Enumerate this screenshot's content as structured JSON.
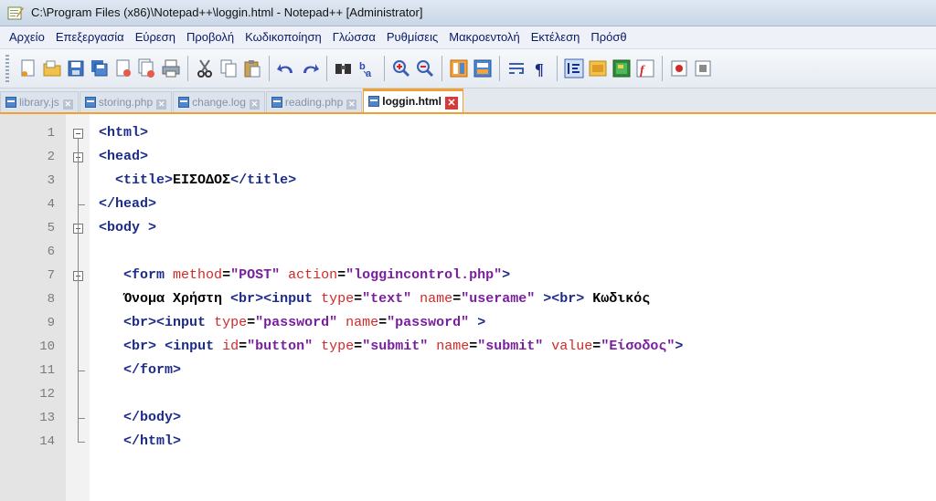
{
  "window": {
    "title": "C:\\Program Files (x86)\\Notepad++\\loggin.html - Notepad++ [Administrator]"
  },
  "menu": [
    "Αρχείο",
    "Επεξεργασία",
    "Εύρεση",
    "Προβολή",
    "Κωδικοποίηση",
    "Γλώσσα",
    "Ρυθμίσεις",
    "Μακροεντολή",
    "Εκτέλεση",
    "Πρόσθ"
  ],
  "toolbar_icons": [
    "new-file-icon",
    "open-file-icon",
    "save-icon",
    "save-all-icon",
    "close-icon",
    "close-all-icon",
    "print-icon",
    "cut-icon",
    "copy-icon",
    "paste-icon",
    "undo-icon",
    "redo-icon",
    "find-icon",
    "replace-icon",
    "zoom-in-icon",
    "zoom-out-icon",
    "sync-vertical-icon",
    "sync-horizontal-icon",
    "word-wrap-icon",
    "show-all-chars-icon",
    "indent-guide-icon",
    "user-defined-lang-icon",
    "document-map-icon",
    "function-list-icon",
    "record-macro-icon",
    "stop-record-icon"
  ],
  "tabs": [
    {
      "label": "library.js",
      "active": false
    },
    {
      "label": "storing.php",
      "active": false
    },
    {
      "label": "change.log",
      "active": false
    },
    {
      "label": "reading.php",
      "active": false
    },
    {
      "label": "loggin.html",
      "active": true
    }
  ],
  "editor": {
    "lines": [
      {
        "n": "1",
        "text": "<html>"
      },
      {
        "n": "2",
        "text": "<head>"
      },
      {
        "n": "3",
        "text": "<title>ΕΙΣΟΔΟΣ</title>"
      },
      {
        "n": "4",
        "text": "</head>"
      },
      {
        "n": "5",
        "text": "<body >"
      },
      {
        "n": "6",
        "text": ""
      },
      {
        "n": "7",
        "text": "<form method=\"POST\" action=\"loggincontrol.php\">"
      },
      {
        "n": "8",
        "text": "Όνομα Χρήστη <br><input type=\"text\" name=\"userame\" ><br> Κωδικός"
      },
      {
        "n": "9",
        "text": "<br><input type=\"password\" name=\"password\" >"
      },
      {
        "n": "10",
        "text": "<br> <input id=\"button\" type=\"submit\" name=\"submit\" value=\"Είσοδος\">"
      },
      {
        "n": "11",
        "text": "</form>"
      },
      {
        "n": "12",
        "text": ""
      },
      {
        "n": "13",
        "text": "</body>"
      },
      {
        "n": "14",
        "text": "</html>"
      }
    ]
  },
  "colors": {
    "tag": "#1c2b8a",
    "attribute": "#d42828",
    "value": "#7a1ea0",
    "active_tab_accent": "#f0a030"
  }
}
